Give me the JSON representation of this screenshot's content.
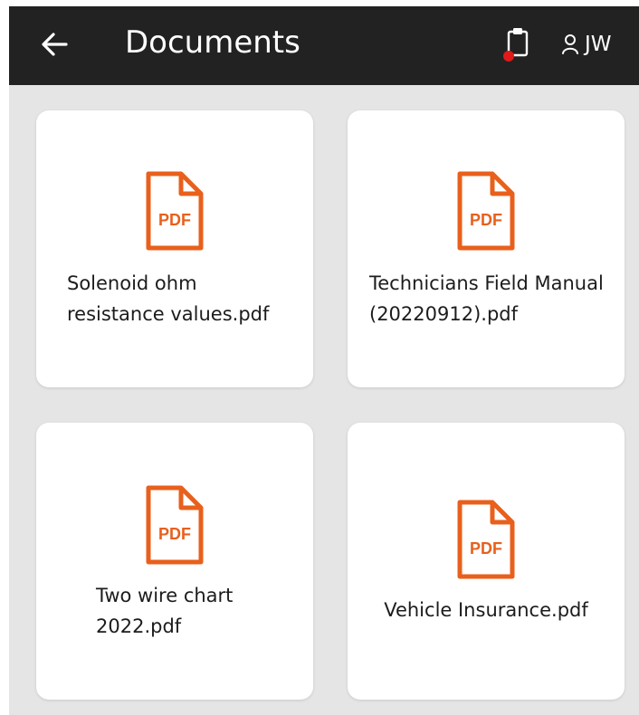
{
  "header": {
    "title": "Documents",
    "user_initials": "JW",
    "back_icon": "back-arrow-icon",
    "clipboard_icon": "clipboard-icon",
    "user_icon": "user-icon"
  },
  "documents": [
    {
      "name": "Solenoid ohm resistance values.pdf",
      "icon_label": "PDF"
    },
    {
      "name": "Technicians Field Manual (20220912).pdf",
      "icon_label": "PDF"
    },
    {
      "name": "Two wire chart 2022.pdf",
      "icon_label": "PDF"
    },
    {
      "name": "Vehicle Insurance.pdf",
      "icon_label": "PDF"
    }
  ],
  "colors": {
    "header_bg": "#222222",
    "page_bg": "#e5e5e5",
    "pdf_orange": "#e8601c",
    "notification_dot": "#e01a1a"
  }
}
